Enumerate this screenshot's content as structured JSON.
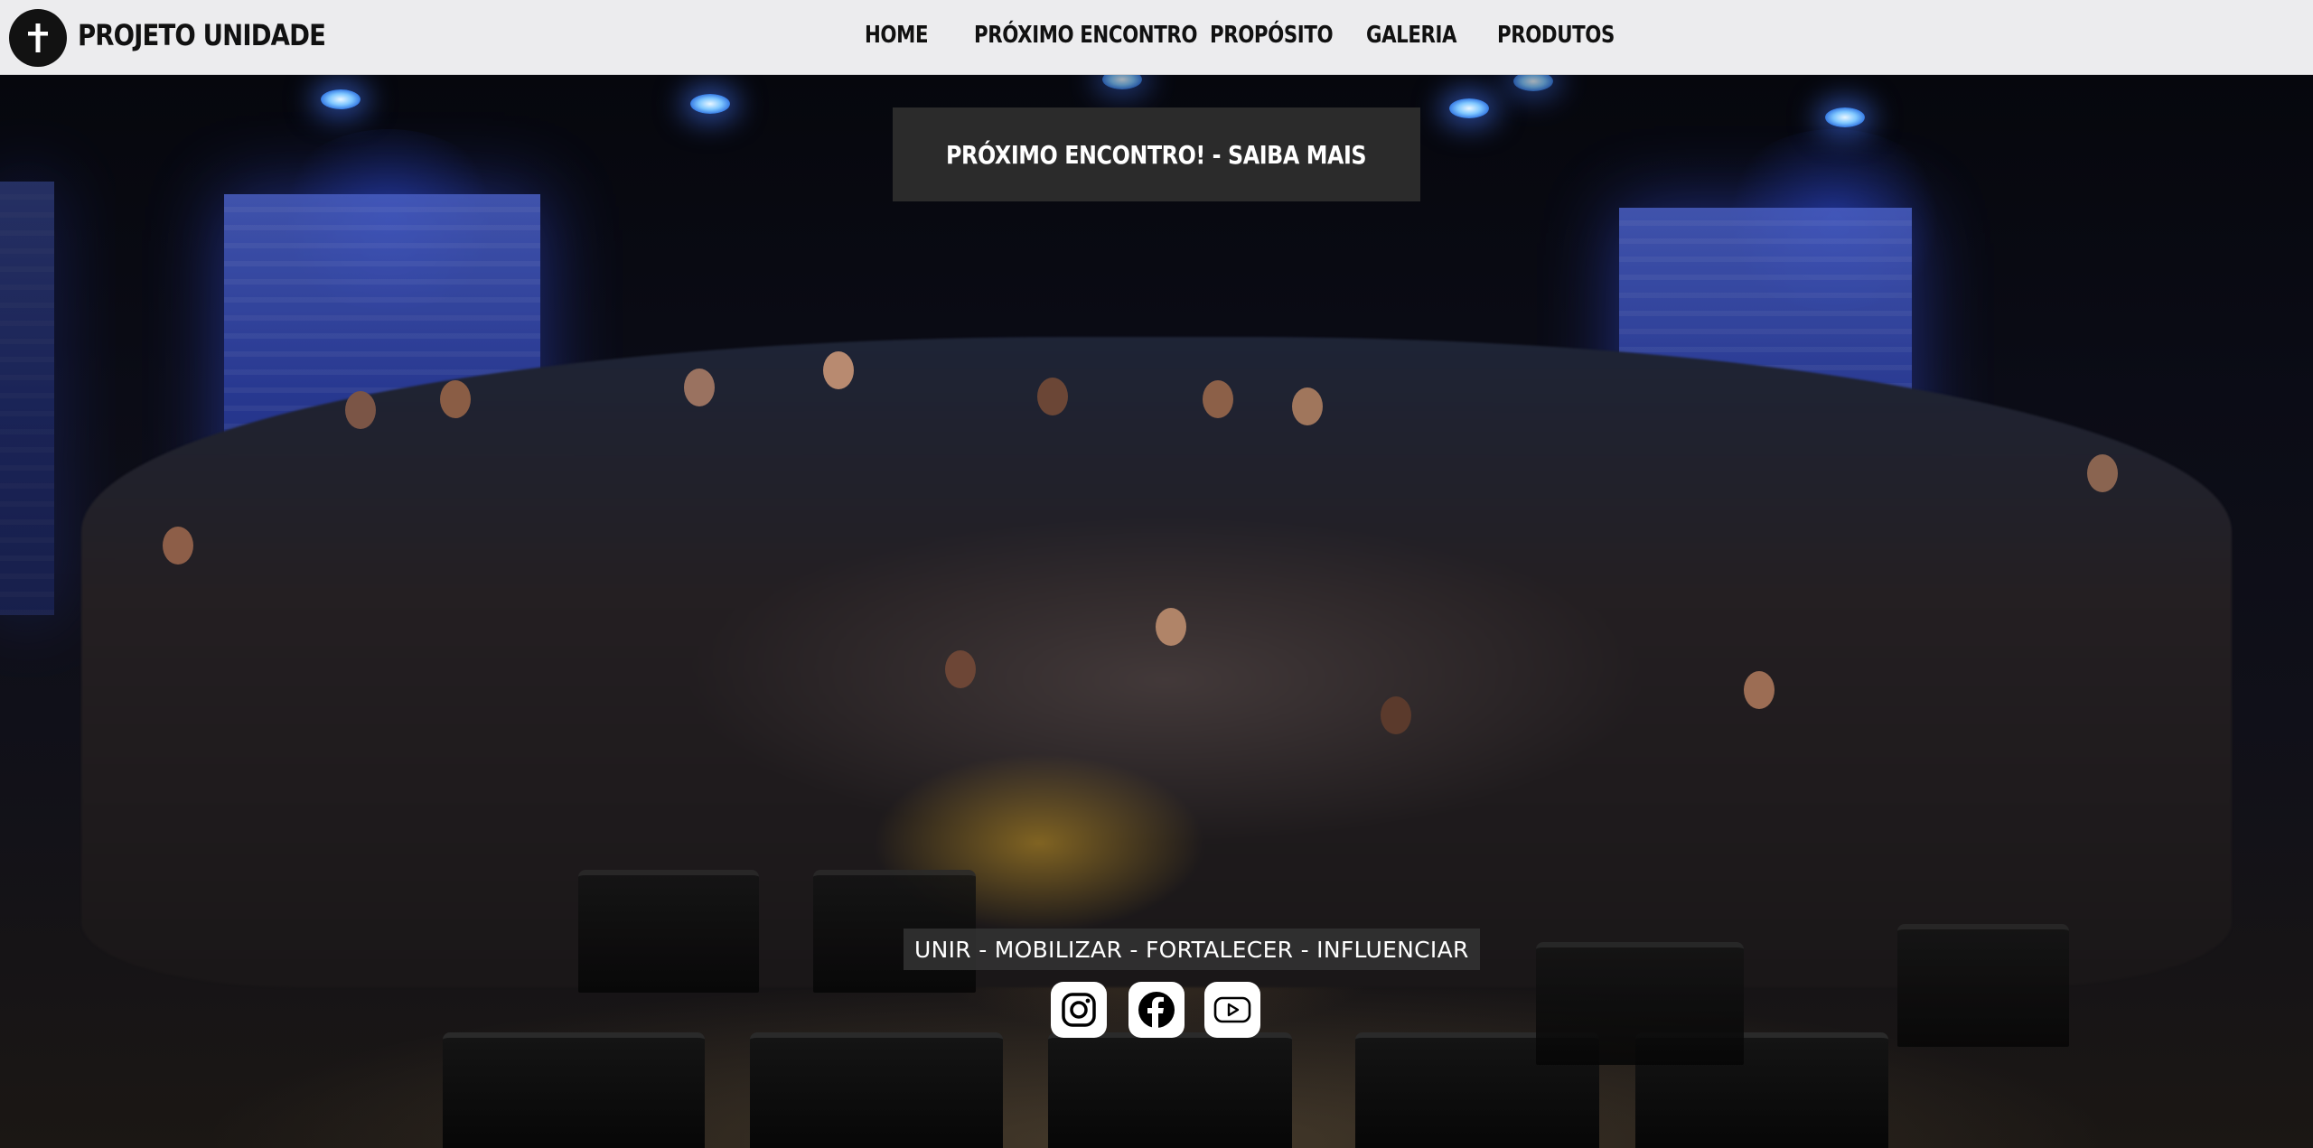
{
  "header": {
    "brand": "PROJETO UNIDADE",
    "logo_icon": "cross-icon",
    "nav": [
      {
        "label": "HOME"
      },
      {
        "label": "PRÓXIMO ENCONTRO"
      },
      {
        "label": "PROPÓSITO"
      },
      {
        "label": "GALERIA"
      },
      {
        "label": "PRODUTOS"
      }
    ]
  },
  "hero": {
    "cta_label": "PRÓXIMO ENCONTRO! - SAIBA MAIS",
    "tagline": "UNIR - MOBILIZAR - FORTALECER - INFLUENCIAR",
    "background": "group-photo",
    "social": [
      {
        "icon": "instagram-icon"
      },
      {
        "icon": "facebook-icon"
      },
      {
        "icon": "youtube-icon"
      }
    ]
  },
  "colors": {
    "header_bg": "#ececee",
    "cta_bg": "#2b2b2b",
    "stage_blue": "#2c3fa4"
  }
}
